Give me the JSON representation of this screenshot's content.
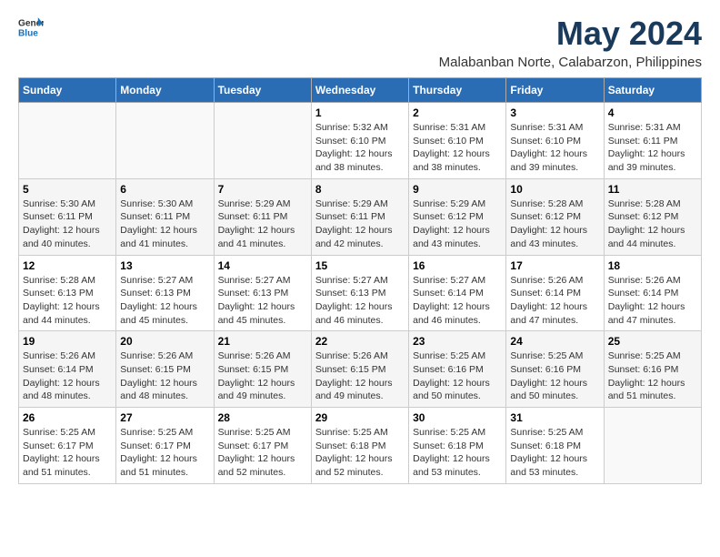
{
  "logo": {
    "text_general": "General",
    "text_blue": "Blue"
  },
  "title": "May 2024",
  "subtitle": "Malabanban Norte, Calabarzon, Philippines",
  "headers": [
    "Sunday",
    "Monday",
    "Tuesday",
    "Wednesday",
    "Thursday",
    "Friday",
    "Saturday"
  ],
  "weeks": [
    [
      {
        "day": "",
        "sunrise": "",
        "sunset": "",
        "daylight": "",
        "empty": true
      },
      {
        "day": "",
        "sunrise": "",
        "sunset": "",
        "daylight": "",
        "empty": true
      },
      {
        "day": "",
        "sunrise": "",
        "sunset": "",
        "daylight": "",
        "empty": true
      },
      {
        "day": "1",
        "sunrise": "Sunrise: 5:32 AM",
        "sunset": "Sunset: 6:10 PM",
        "daylight": "Daylight: 12 hours and 38 minutes."
      },
      {
        "day": "2",
        "sunrise": "Sunrise: 5:31 AM",
        "sunset": "Sunset: 6:10 PM",
        "daylight": "Daylight: 12 hours and 38 minutes."
      },
      {
        "day": "3",
        "sunrise": "Sunrise: 5:31 AM",
        "sunset": "Sunset: 6:10 PM",
        "daylight": "Daylight: 12 hours and 39 minutes."
      },
      {
        "day": "4",
        "sunrise": "Sunrise: 5:31 AM",
        "sunset": "Sunset: 6:11 PM",
        "daylight": "Daylight: 12 hours and 39 minutes."
      }
    ],
    [
      {
        "day": "5",
        "sunrise": "Sunrise: 5:30 AM",
        "sunset": "Sunset: 6:11 PM",
        "daylight": "Daylight: 12 hours and 40 minutes."
      },
      {
        "day": "6",
        "sunrise": "Sunrise: 5:30 AM",
        "sunset": "Sunset: 6:11 PM",
        "daylight": "Daylight: 12 hours and 41 minutes."
      },
      {
        "day": "7",
        "sunrise": "Sunrise: 5:29 AM",
        "sunset": "Sunset: 6:11 PM",
        "daylight": "Daylight: 12 hours and 41 minutes."
      },
      {
        "day": "8",
        "sunrise": "Sunrise: 5:29 AM",
        "sunset": "Sunset: 6:11 PM",
        "daylight": "Daylight: 12 hours and 42 minutes."
      },
      {
        "day": "9",
        "sunrise": "Sunrise: 5:29 AM",
        "sunset": "Sunset: 6:12 PM",
        "daylight": "Daylight: 12 hours and 43 minutes."
      },
      {
        "day": "10",
        "sunrise": "Sunrise: 5:28 AM",
        "sunset": "Sunset: 6:12 PM",
        "daylight": "Daylight: 12 hours and 43 minutes."
      },
      {
        "day": "11",
        "sunrise": "Sunrise: 5:28 AM",
        "sunset": "Sunset: 6:12 PM",
        "daylight": "Daylight: 12 hours and 44 minutes."
      }
    ],
    [
      {
        "day": "12",
        "sunrise": "Sunrise: 5:28 AM",
        "sunset": "Sunset: 6:13 PM",
        "daylight": "Daylight: 12 hours and 44 minutes."
      },
      {
        "day": "13",
        "sunrise": "Sunrise: 5:27 AM",
        "sunset": "Sunset: 6:13 PM",
        "daylight": "Daylight: 12 hours and 45 minutes."
      },
      {
        "day": "14",
        "sunrise": "Sunrise: 5:27 AM",
        "sunset": "Sunset: 6:13 PM",
        "daylight": "Daylight: 12 hours and 45 minutes."
      },
      {
        "day": "15",
        "sunrise": "Sunrise: 5:27 AM",
        "sunset": "Sunset: 6:13 PM",
        "daylight": "Daylight: 12 hours and 46 minutes."
      },
      {
        "day": "16",
        "sunrise": "Sunrise: 5:27 AM",
        "sunset": "Sunset: 6:14 PM",
        "daylight": "Daylight: 12 hours and 46 minutes."
      },
      {
        "day": "17",
        "sunrise": "Sunrise: 5:26 AM",
        "sunset": "Sunset: 6:14 PM",
        "daylight": "Daylight: 12 hours and 47 minutes."
      },
      {
        "day": "18",
        "sunrise": "Sunrise: 5:26 AM",
        "sunset": "Sunset: 6:14 PM",
        "daylight": "Daylight: 12 hours and 47 minutes."
      }
    ],
    [
      {
        "day": "19",
        "sunrise": "Sunrise: 5:26 AM",
        "sunset": "Sunset: 6:14 PM",
        "daylight": "Daylight: 12 hours and 48 minutes."
      },
      {
        "day": "20",
        "sunrise": "Sunrise: 5:26 AM",
        "sunset": "Sunset: 6:15 PM",
        "daylight": "Daylight: 12 hours and 48 minutes."
      },
      {
        "day": "21",
        "sunrise": "Sunrise: 5:26 AM",
        "sunset": "Sunset: 6:15 PM",
        "daylight": "Daylight: 12 hours and 49 minutes."
      },
      {
        "day": "22",
        "sunrise": "Sunrise: 5:26 AM",
        "sunset": "Sunset: 6:15 PM",
        "daylight": "Daylight: 12 hours and 49 minutes."
      },
      {
        "day": "23",
        "sunrise": "Sunrise: 5:25 AM",
        "sunset": "Sunset: 6:16 PM",
        "daylight": "Daylight: 12 hours and 50 minutes."
      },
      {
        "day": "24",
        "sunrise": "Sunrise: 5:25 AM",
        "sunset": "Sunset: 6:16 PM",
        "daylight": "Daylight: 12 hours and 50 minutes."
      },
      {
        "day": "25",
        "sunrise": "Sunrise: 5:25 AM",
        "sunset": "Sunset: 6:16 PM",
        "daylight": "Daylight: 12 hours and 51 minutes."
      }
    ],
    [
      {
        "day": "26",
        "sunrise": "Sunrise: 5:25 AM",
        "sunset": "Sunset: 6:17 PM",
        "daylight": "Daylight: 12 hours and 51 minutes."
      },
      {
        "day": "27",
        "sunrise": "Sunrise: 5:25 AM",
        "sunset": "Sunset: 6:17 PM",
        "daylight": "Daylight: 12 hours and 51 minutes."
      },
      {
        "day": "28",
        "sunrise": "Sunrise: 5:25 AM",
        "sunset": "Sunset: 6:17 PM",
        "daylight": "Daylight: 12 hours and 52 minutes."
      },
      {
        "day": "29",
        "sunrise": "Sunrise: 5:25 AM",
        "sunset": "Sunset: 6:18 PM",
        "daylight": "Daylight: 12 hours and 52 minutes."
      },
      {
        "day": "30",
        "sunrise": "Sunrise: 5:25 AM",
        "sunset": "Sunset: 6:18 PM",
        "daylight": "Daylight: 12 hours and 53 minutes."
      },
      {
        "day": "31",
        "sunrise": "Sunrise: 5:25 AM",
        "sunset": "Sunset: 6:18 PM",
        "daylight": "Daylight: 12 hours and 53 minutes."
      },
      {
        "day": "",
        "sunrise": "",
        "sunset": "",
        "daylight": "",
        "empty": true
      }
    ]
  ]
}
